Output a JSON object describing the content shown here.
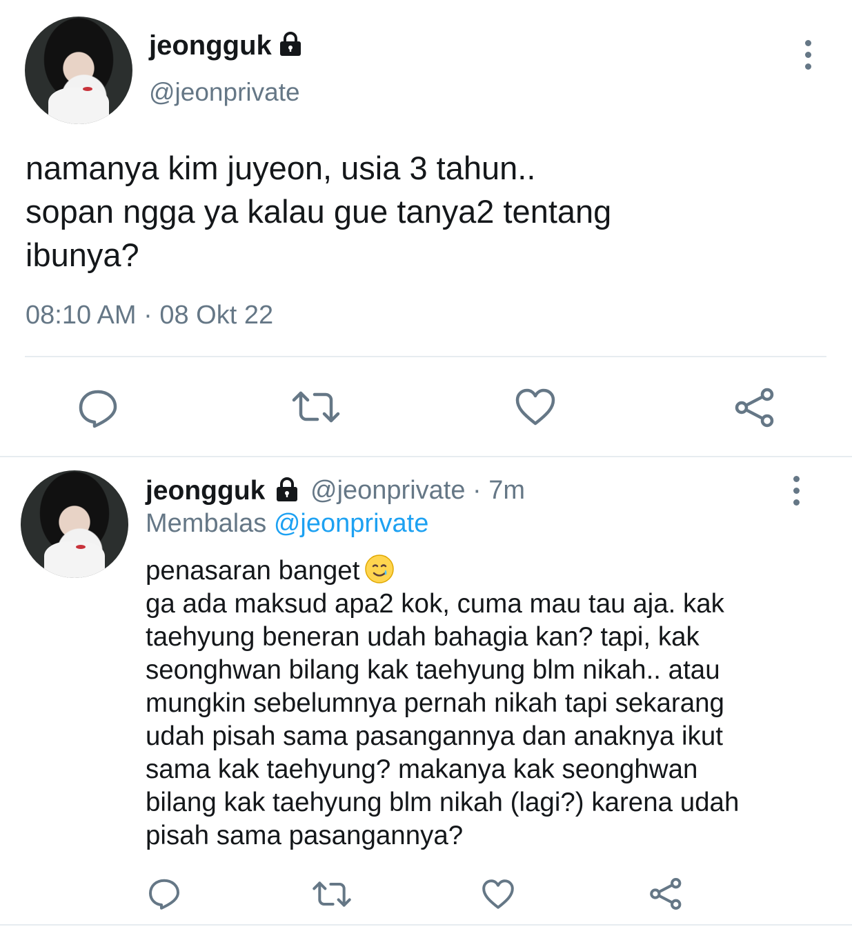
{
  "main_tweet": {
    "display_name": "jeongguk",
    "handle": "@jeonprivate",
    "text": "namanya kim juyeon, usia 3 tahun..\nsopan ngga ya kalau gue tanya2 tentang\nibunya?",
    "timestamp": "08:10 AM · 08 Okt 22",
    "icons": [
      "lock-icon",
      "kebab-menu-icon",
      "reply-icon",
      "retweet-icon",
      "like-icon",
      "share-icon"
    ]
  },
  "reply_tweet": {
    "display_name": "jeongguk",
    "handle": "@jeonprivate",
    "time_ago": "· 7m",
    "replying_label": "Membalas",
    "replying_to": "@jeonprivate",
    "lines": [
      "penasaran banget",
      "ga ada maksud apa2 kok, cuma mau tau aja. kak",
      "taehyung beneran udah bahagia kan? tapi, kak",
      "seonghwan bilang kak taehyung blm nikah.. atau",
      "mungkin sebelumnya pernah nikah tapi sekarang",
      "udah pisah sama pasangannya dan anaknya ikut",
      "sama kak taehyung? makanya kak seonghwan",
      "bilang kak taehyung blm nikah (lagi?) karena udah",
      "pisah sama pasangannya?"
    ],
    "emoji": "smiling-face-with-tear-icon"
  },
  "colors": {
    "text": "#14171a",
    "muted": "#657786",
    "accent": "#1da1f2",
    "divider": "#e6ecf0"
  }
}
